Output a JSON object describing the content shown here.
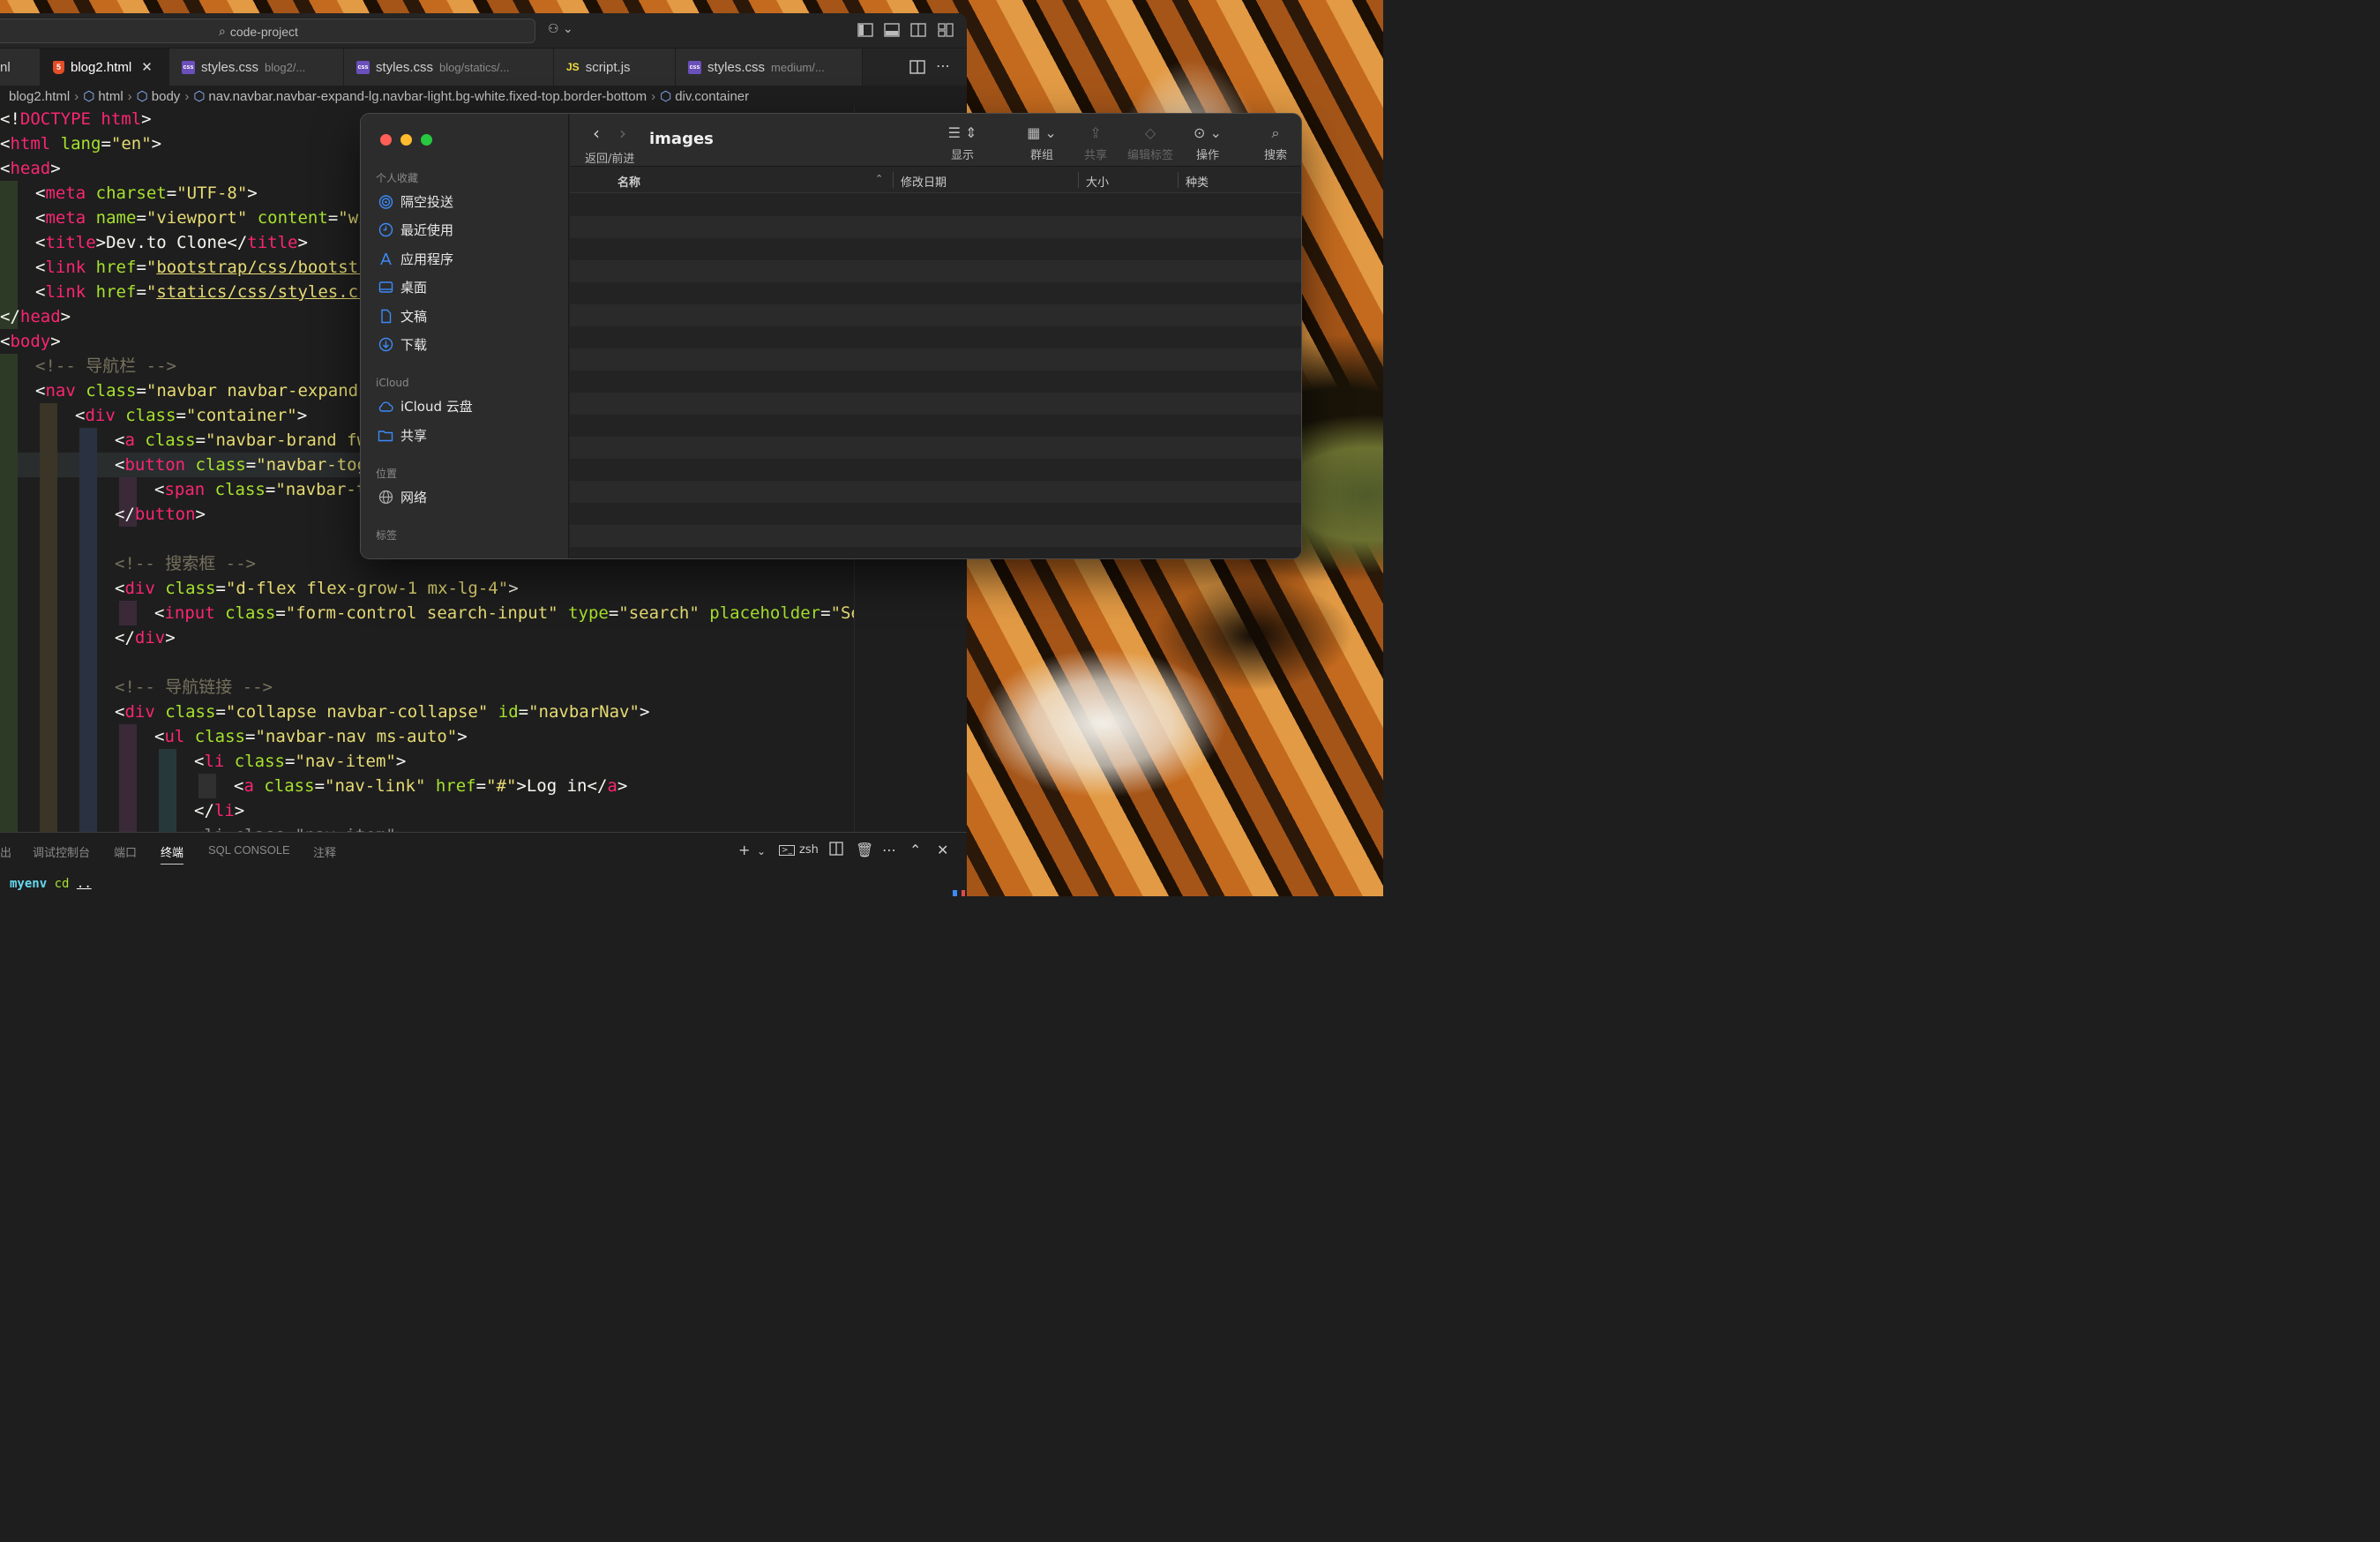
{
  "vscode": {
    "command_center": "code-project",
    "tabs": [
      {
        "name": "nl",
        "type": "plain"
      },
      {
        "name": "blog2.html",
        "type": "html",
        "active": true
      },
      {
        "name": "styles.css",
        "sub": "blog2/...",
        "type": "css"
      },
      {
        "name": "styles.css",
        "sub": "blog/statics/...",
        "type": "css"
      },
      {
        "name": "script.js",
        "type": "js"
      },
      {
        "name": "styles.css",
        "sub": "medium/...",
        "type": "css"
      }
    ],
    "breadcrumb": [
      "blog2.html",
      "html",
      "body",
      "nav.navbar.navbar-expand-lg.navbar-light.bg-white.fixed-top.border-bottom",
      "div.container"
    ],
    "code": {
      "l1": [
        "<!",
        "DOCTYPE html",
        ">"
      ],
      "l2": [
        "<",
        "html",
        " ",
        "lang",
        "=",
        "\"en\"",
        ">"
      ],
      "l3": [
        "<",
        "head",
        ">"
      ],
      "l4": [
        "<",
        "meta",
        " ",
        "charset",
        "=",
        "\"UTF-8\"",
        ">"
      ],
      "l5": [
        "<",
        "meta",
        " ",
        "name",
        "=",
        "\"viewport\"",
        " ",
        "content",
        "=",
        "\"wi"
      ],
      "l6": [
        "<",
        "title",
        ">",
        "Dev.to Clone",
        "</",
        "title",
        ">"
      ],
      "l7": [
        "<",
        "link",
        " ",
        "href",
        "=",
        "\"",
        "bootstrap/css/bootstr"
      ],
      "l8": [
        "<",
        "link",
        " ",
        "href",
        "=",
        "\"",
        "statics/css/styles.cs"
      ],
      "l9": [
        "</",
        "head",
        ">"
      ],
      "l10": [
        "<",
        "body",
        ">"
      ],
      "l11": "<!-- 导航栏 -->",
      "l12": [
        "<",
        "nav",
        " ",
        "class",
        "=",
        "\"navbar navbar-expand-"
      ],
      "l13": [
        "<",
        "div",
        " ",
        "class",
        "=",
        "\"container\"",
        ">"
      ],
      "l14": [
        "<",
        "a",
        " ",
        "class",
        "=",
        "\"navbar-brand fw"
      ],
      "l15": [
        "<",
        "button",
        " ",
        "class",
        "=",
        "\"navbar-tog"
      ],
      "l16": [
        "<",
        "span",
        " ",
        "class",
        "=",
        "\"navbar-t"
      ],
      "l17": [
        "</",
        "button",
        ">"
      ],
      "l19": "<!-- 搜索框 -->",
      "l20": [
        "<",
        "div",
        " ",
        "class",
        "=",
        "\"d-flex flex-grow-1 mx-lg-4\"",
        ">"
      ],
      "l21": [
        "<",
        "input",
        " ",
        "class",
        "=",
        "\"form-control search-input\"",
        " ",
        "type",
        "=",
        "\"search\"",
        " ",
        "placeholder",
        "=",
        "\"Sea"
      ],
      "l22": [
        "</",
        "div",
        ">"
      ],
      "l24": "<!-- 导航链接 -->",
      "l25": [
        "<",
        "div",
        " ",
        "class",
        "=",
        "\"collapse navbar-collapse\"",
        " ",
        "id",
        "=",
        "\"navbarNav\"",
        ">"
      ],
      "l26": [
        "<",
        "ul",
        " ",
        "class",
        "=",
        "\"navbar-nav ms-auto\"",
        ">"
      ],
      "l27": [
        "<",
        "li",
        " ",
        "class",
        "=",
        "\"nav-item\"",
        ">"
      ],
      "l28": [
        "<",
        "a",
        " ",
        "class",
        "=",
        "\"nav-link\"",
        " ",
        "href",
        "=",
        "\"#\"",
        ">",
        "Log in",
        "</",
        "a",
        ">"
      ],
      "l29": [
        "</",
        "li",
        ">"
      ],
      "l30": "<li class=\"nav-item\">"
    },
    "panel": {
      "tabs": [
        "出",
        "调试控制台",
        "端口",
        "终端",
        "SQL CONSOLE",
        "注释"
      ],
      "active_tab": "终端",
      "shell": "zsh",
      "terminal_env": "myenv",
      "terminal_cmd": "cd",
      "terminal_arg": ".."
    }
  },
  "finder": {
    "title": "images",
    "nav_label": "返回/前进",
    "toolbar": {
      "view": "显示",
      "group": "群组",
      "share": "共享",
      "tags": "编辑标签",
      "action": "操作",
      "search": "搜索"
    },
    "sidebar": {
      "favorites_header": "个人收藏",
      "favorites": [
        "隔空投送",
        "最近使用",
        "应用程序",
        "桌面",
        "文稿",
        "下载"
      ],
      "icloud_header": "iCloud",
      "icloud": [
        "iCloud 云盘",
        "共享"
      ],
      "locations_header": "位置",
      "locations": [
        "网络"
      ],
      "tags_header": "标签"
    },
    "columns": [
      "名称",
      "修改日期",
      "大小",
      "种类"
    ]
  },
  "colors": {
    "tag": "#f92672",
    "attr": "#a6e22e",
    "string": "#e6db74",
    "comment": "#75715e",
    "accent_blue": "#3d8af7",
    "close": "#ff5f57",
    "minimize": "#febc2e",
    "zoom": "#28c840"
  }
}
